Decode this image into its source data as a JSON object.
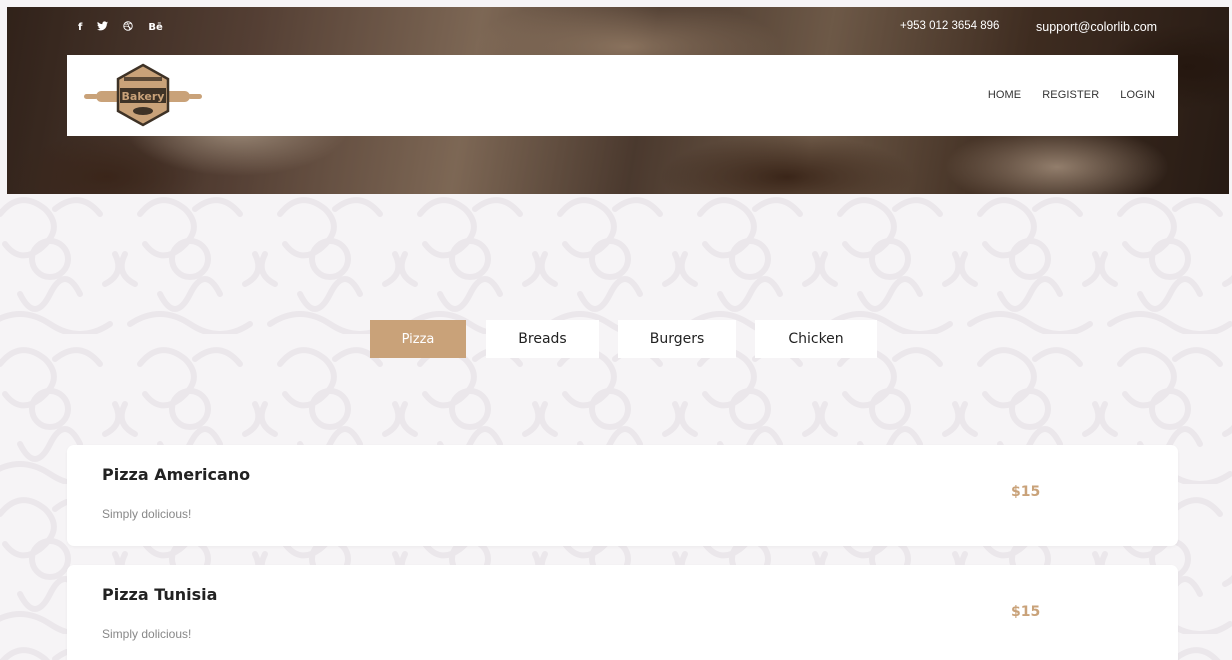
{
  "topbar": {
    "socials": [
      {
        "glyph": "f",
        "icon": "facebook-icon"
      },
      {
        "glyph": "🐦",
        "icon": "twitter-icon"
      },
      {
        "glyph": "⊙",
        "icon": "dribbble-icon"
      },
      {
        "glyph": "Bē",
        "icon": "behance-icon"
      }
    ],
    "phone": "+953 012 3654 896",
    "email": "support@colorlib.com"
  },
  "header": {
    "logo_text": "Bakery",
    "nav": [
      "HOME",
      "REGISTER",
      "LOGIN"
    ]
  },
  "tabs": [
    {
      "label": "Pizza",
      "active": true
    },
    {
      "label": "Breads",
      "active": false
    },
    {
      "label": "Burgers",
      "active": false
    },
    {
      "label": "Chicken",
      "active": false
    }
  ],
  "menu_items": [
    {
      "name": "Pizza Americano",
      "description": "Simply dolicious!",
      "price": "$15"
    },
    {
      "name": "Pizza Tunisia",
      "description": "Simply dolicious!",
      "price": "$15"
    }
  ],
  "colors": {
    "accent": "#c9a279",
    "logo_dark": "#3e3226"
  }
}
